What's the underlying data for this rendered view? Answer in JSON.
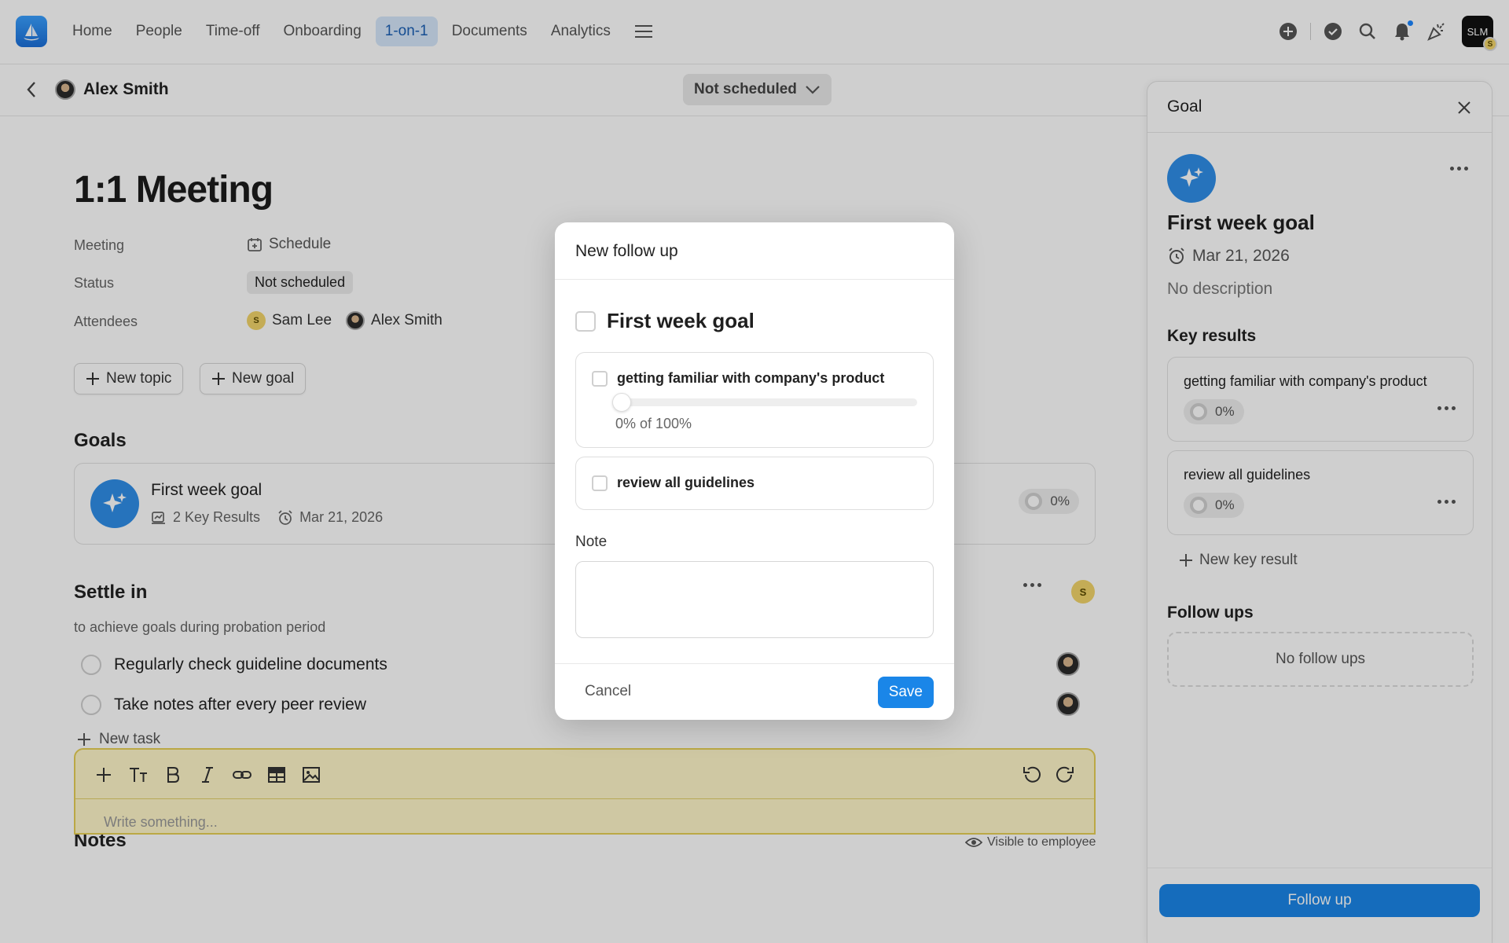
{
  "nav": {
    "items": [
      "Home",
      "People",
      "Time-off",
      "Onboarding",
      "1-on-1",
      "Documents",
      "Analytics"
    ],
    "active_index": 4
  },
  "user": {
    "initials": "SLM",
    "badge": "S"
  },
  "subheader": {
    "person_name": "Alex Smith",
    "schedule_status": "Not scheduled"
  },
  "meeting": {
    "title": "1:1 Meeting",
    "meeting_label": "Meeting",
    "schedule_link": "Schedule",
    "status_label": "Status",
    "status_value": "Not scheduled",
    "attendees_label": "Attendees",
    "attendees": [
      {
        "name": "Sam Lee",
        "initial": "S"
      },
      {
        "name": "Alex Smith"
      }
    ],
    "new_topic": "New topic",
    "new_goal": "New goal"
  },
  "goals_section": {
    "heading": "Goals",
    "goal": {
      "title": "First week goal",
      "key_results": "2 Key Results",
      "date": "Mar 21, 2026",
      "progress": "0%"
    }
  },
  "settle": {
    "heading": "Settle in",
    "description": "to achieve goals during probation period",
    "owner_initial": "S",
    "tasks": [
      "Regularly check guideline documents",
      "Take notes after every peer review"
    ],
    "new_task": "New task"
  },
  "notes": {
    "heading": "Notes",
    "visibility": "Visible to employee",
    "placeholder": "Write something..."
  },
  "panel": {
    "title": "Goal",
    "goal_title": "First week goal",
    "date": "Mar 21, 2026",
    "description": "No description",
    "key_results_heading": "Key results",
    "key_results": [
      {
        "title": "getting familiar with company's product",
        "progress": "0%"
      },
      {
        "title": "review all guidelines",
        "progress": "0%"
      }
    ],
    "new_key_result": "New key result",
    "follow_ups_heading": "Follow ups",
    "no_follow_ups": "No follow ups",
    "follow_up_button": "Follow up"
  },
  "modal": {
    "title": "New follow up",
    "goal_title": "First week goal",
    "key_results": [
      {
        "title": "getting familiar with company's product",
        "progress_text": "0% of 100%",
        "progress_fraction": 0
      },
      {
        "title": "review all guidelines"
      }
    ],
    "note_label": "Note",
    "note_value": "",
    "cancel": "Cancel",
    "save": "Save"
  },
  "colors": {
    "accent": "#1a86e8",
    "active_nav_bg": "#d5e7fb",
    "notes_bg": "#fff7c9",
    "goal_icon": "#2f8ee8"
  }
}
